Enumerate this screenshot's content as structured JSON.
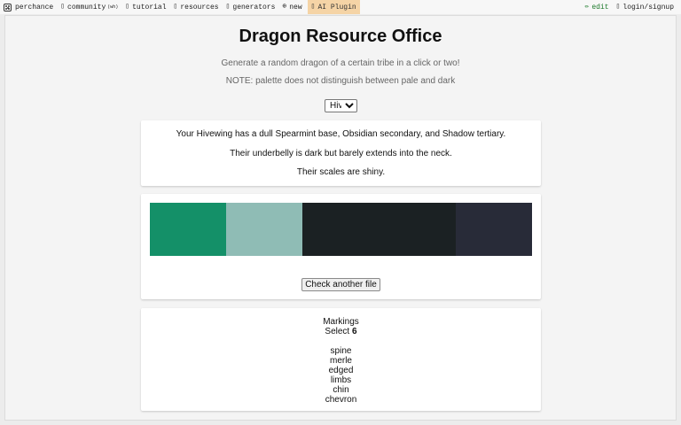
{
  "nav": {
    "brand": "perchance",
    "community": "community",
    "community_badge": "(wh)",
    "tutorial": "tutorial",
    "resources": "resources",
    "generators": "generators",
    "new": "new",
    "ai_plugin": "AI Plugin",
    "edit": "edit",
    "login": "login/signup"
  },
  "page": {
    "title": "Dragon Resource Office",
    "subtitle": "Generate a random dragon of a certain tribe in a click or two!",
    "note": "NOTE: palette does not distinguish between pale and dark",
    "tribe_selected": "Hive"
  },
  "description": {
    "line1": "Your Hivewing has a dull Spearmint base, Obsidian secondary, and Shadow tertiary.",
    "line2": "Their underbelly is dark but barely extends into the neck.",
    "line3": "Their scales are shiny."
  },
  "palette": {
    "colors": [
      "#149068",
      "#8fbcb5",
      "#1b2123",
      "#1b2123",
      "#282b38"
    ],
    "button_label": "Check another file"
  },
  "markings": {
    "heading": "Markings",
    "select_prefix": "Select ",
    "select_count": "6",
    "items": [
      "spine",
      "merle",
      "edged",
      "limbs",
      "chin",
      "chevron"
    ]
  }
}
